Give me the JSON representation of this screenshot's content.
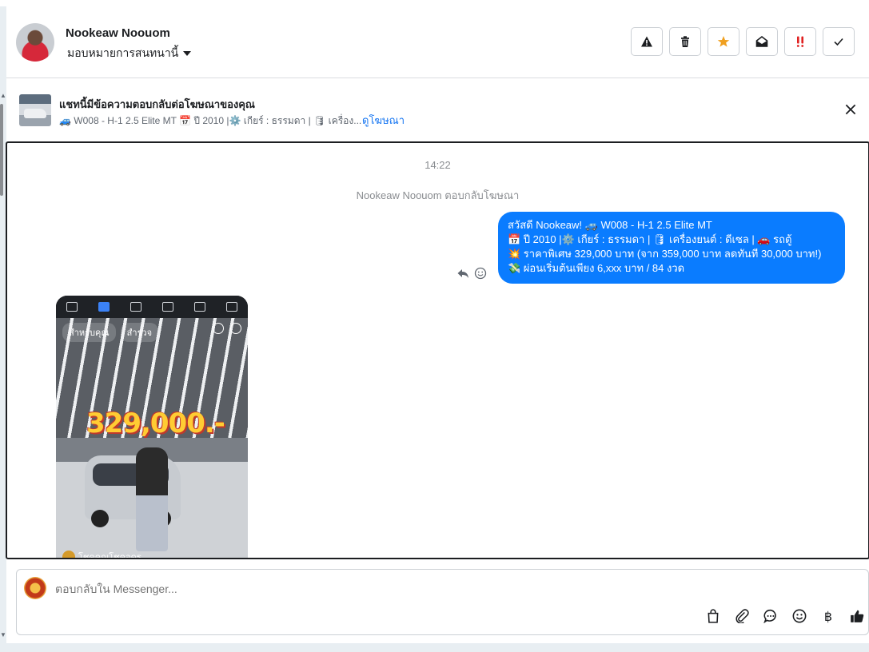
{
  "header": {
    "contact_name": "Nookeaw Noouom",
    "assign_label": "มอบหมายการสนทนานี้",
    "actions": [
      {
        "name": "report-button",
        "icon": "warning-icon"
      },
      {
        "name": "delete-button",
        "icon": "trash-icon"
      },
      {
        "name": "star-button",
        "icon": "star-icon",
        "color": "#f0a020"
      },
      {
        "name": "mark-unread-button",
        "icon": "envelope-open-icon"
      },
      {
        "name": "spam-button",
        "icon": "double-exclaim-icon",
        "color": "#e02020"
      },
      {
        "name": "done-button",
        "icon": "check-icon"
      }
    ]
  },
  "ad": {
    "title": "แชทนี้มีข้อความตอบกลับต่อโฆษณาของคุณ",
    "subtitle": "🚙 W008 - H-1 2.5 Elite MT 📅 ปี 2010 |⚙️ เกียร์ : ธรรมดา | 🛢 เครื่อง...",
    "link": "ดูโฆษณา"
  },
  "chat": {
    "time": "14:22",
    "reply_note": "Nookeaw Noouom ตอบกลับโฆษณา",
    "message_lines": [
      "สวัสดี Nookeaw! 🚙 W008 - H-1 2.5 Elite MT",
      "📅 ปี 2010 |⚙️ เกียร์ : ธรรมดา | 🛢 เครื่องยนต์ : ดีเซล | 🚗 รถตู้",
      "💥 ราคาพิเศษ 329,000 บาท (จาก 359,000 บาท ลดทันที 30,000 บาท!)",
      "💸 ผ่อนเริ่มต้นเพียง 6,xxx บาท / 84 งวด"
    ],
    "attachment": {
      "tab_for_you": "สำหรับคุณ",
      "tab_explore": "สำรวจ",
      "price_text": "329,000.-",
      "account_name": "โชคคูณโชคอุดร"
    }
  },
  "composer": {
    "placeholder": "ตอบกลับใน Messenger...",
    "currency_symbol": "฿"
  },
  "colors": {
    "bubble": "#0a7cff",
    "link": "#1877f2"
  }
}
